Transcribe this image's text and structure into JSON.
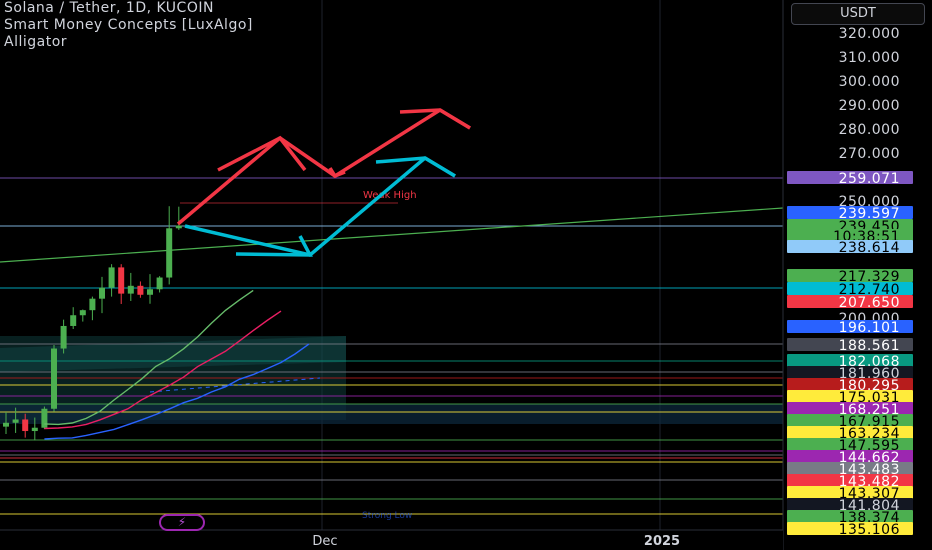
{
  "legend": {
    "title": "Solana / Tether, 1D, KUCOIN",
    "indicator1": "Smart Money Concepts [LuxAlgo]",
    "indicator2": "Alligator"
  },
  "currency": "USDT",
  "colors": {
    "bull": "#26a69a",
    "bear": "#ef5350",
    "candle_bull": "#4caf50",
    "candle_bear": "#f23645",
    "red_arrow": "#f23645",
    "cyan_arrow": "#00bcd4",
    "trend_line": "#4caf50",
    "alligator_lips": "#66bb6a",
    "alligator_teeth": "#e91e63",
    "alligator_jaw": "#2962ff",
    "weak_high_line": "#7e57c2"
  },
  "chart_data": {
    "type": "candlestick",
    "y_axis": {
      "ticks": [
        "320.000",
        "310.000",
        "300.000",
        "290.000",
        "280.000",
        "270.000",
        "250.000",
        "200.000"
      ],
      "range": [
        134,
        325
      ]
    },
    "x_axis": {
      "ticks": [
        "Dec",
        "2025"
      ]
    },
    "candles": [
      {
        "o": 160.5,
        "h": 165.8,
        "l": 157.8,
        "c": 161.9
      },
      {
        "o": 161.9,
        "h": 167.4,
        "l": 158.2,
        "c": 163.1
      },
      {
        "o": 163.1,
        "h": 165.2,
        "l": 156.5,
        "c": 158.9
      },
      {
        "o": 158.9,
        "h": 163.8,
        "l": 155.5,
        "c": 160.1
      },
      {
        "o": 160.1,
        "h": 167.8,
        "l": 159.6,
        "c": 167.0
      },
      {
        "o": 167.0,
        "h": 190.2,
        "l": 165.9,
        "c": 188.9
      },
      {
        "o": 188.9,
        "h": 199.4,
        "l": 187.1,
        "c": 197.1
      },
      {
        "o": 197.1,
        "h": 204.7,
        "l": 196.0,
        "c": 201.2
      },
      {
        "o": 201.2,
        "h": 203.7,
        "l": 198.7,
        "c": 203.4
      },
      {
        "o": 203.4,
        "h": 209.3,
        "l": 199.2,
        "c": 208.4
      },
      {
        "o": 208.4,
        "h": 217.9,
        "l": 202.1,
        "c": 213.2
      },
      {
        "o": 213.2,
        "h": 223.4,
        "l": 209.3,
        "c": 222.0
      },
      {
        "o": 222.0,
        "h": 223.4,
        "l": 206.1,
        "c": 210.6
      },
      {
        "o": 210.6,
        "h": 219.6,
        "l": 207.4,
        "c": 214.0
      },
      {
        "o": 214.0,
        "h": 215.9,
        "l": 208.8,
        "c": 210.1
      },
      {
        "o": 210.1,
        "h": 219.1,
        "l": 206.2,
        "c": 212.5
      },
      {
        "o": 212.5,
        "h": 218.2,
        "l": 211.1,
        "c": 217.6
      },
      {
        "o": 217.6,
        "h": 248.6,
        "l": 214.6,
        "c": 239.0
      },
      {
        "o": 239.0,
        "h": 248.4,
        "l": 238.3,
        "c": 240.2
      }
    ],
    "alligator": {
      "lips": [
        161.5,
        161.3,
        161.8,
        163.5,
        166.1,
        170.2,
        174.0,
        177.9,
        182.4,
        185.2,
        188.8,
        193.1,
        198.1,
        203.3,
        207.8,
        212.0
      ],
      "teeth": [
        159.8,
        160.0,
        160.4,
        161.3,
        163.0,
        165.0,
        167.0,
        170.3,
        172.9,
        175.6,
        178.5,
        182.3,
        185.1,
        187.9,
        191.6,
        195.4,
        199.1,
        203.0
      ],
      "jaw": [
        156.0,
        156.3,
        156.4,
        157.3,
        158.4,
        159.5,
        161.2,
        163.0,
        164.9,
        167.0,
        169.2,
        170.8,
        173.1,
        175.0,
        177.7,
        179.4,
        181.6,
        183.8,
        186.9,
        190.5
      ]
    },
    "horizontal_levels": [
      259.071,
      239.597,
      212.74,
      188.561,
      182.068,
      181.96,
      180.295,
      175.031,
      168.251,
      167.915,
      163.234,
      147.595,
      144.662,
      143.483,
      143.482,
      143.307,
      141.804,
      138.374,
      135.106
    ],
    "price_labels": [
      {
        "value": "259.071",
        "y": 259.071,
        "color": "#7e57c2",
        "text_color": "#ffffff"
      },
      {
        "value": "239.597",
        "y": 244.9,
        "color": "#2962ff",
        "text_color": "#ffffff"
      },
      {
        "value": "239.450",
        "y": 239.8,
        "color": "#4caf50",
        "text_color": "#000000"
      },
      {
        "value": "10:38:51",
        "y": 235.4,
        "color": "#4caf50",
        "text_color": "#000000"
      },
      {
        "value": "238.614",
        "y": 230.6,
        "color": "#90caf9",
        "text_color": "#000000"
      },
      {
        "value": "217.329",
        "y": 217.2,
        "color": "#4caf50",
        "text_color": "#000000"
      },
      {
        "value": "212.740",
        "y": 212.4,
        "color": "#00bcd4",
        "text_color": "#000000"
      },
      {
        "value": "207.650",
        "y": 207.6,
        "color": "#f23645",
        "text_color": "#ffffff"
      },
      {
        "value": "196.101",
        "y": 196.1,
        "color": "#2962ff",
        "text_color": "#ffffff"
      },
      {
        "value": "188.561",
        "y": 188.9,
        "color": "#434651",
        "text_color": "#ffffff"
      },
      {
        "value": "182.068",
        "y": 183.7,
        "color": "#089981",
        "text_color": "#ffffff"
      },
      {
        "value": "181.960",
        "y": 178.8,
        "color": "#131722",
        "text_color": "#d1d4dc"
      },
      {
        "value": "180.295",
        "y": 173.7,
        "color": "#b71c1c",
        "text_color": "#ffffff"
      },
      {
        "value": "175.031",
        "y": 168.6,
        "color": "#ffeb3b",
        "text_color": "#000000"
      },
      {
        "value": "168.251",
        "y": 163.6,
        "color": "#9c27b0",
        "text_color": "#ffffff"
      },
      {
        "value": "167.915",
        "y": 158.7,
        "color": "#4caf50",
        "text_color": "#000000"
      },
      {
        "value": "163.234",
        "y": 153.9,
        "color": "#ffeb3b",
        "text_color": "#000000"
      },
      {
        "value": "147.595",
        "y": 148.8,
        "color": "#4caf50",
        "text_color": "#000000"
      },
      {
        "value": "144.662",
        "y": 143.7,
        "color": "#9c27b0",
        "text_color": "#ffffff"
      },
      {
        "value": "143.483",
        "y": 138.5,
        "color": "#787b86",
        "text_color": "#ffffff"
      },
      {
        "value": "143.482",
        "y": 133.6,
        "color": "#f23645",
        "text_color": "#ffffff"
      },
      {
        "value": "143.307",
        "y": 128.6,
        "color": "#ffeb3b",
        "text_color": "#000000"
      },
      {
        "value": "141.804",
        "y": 123.6,
        "color": "#131722",
        "text_color": "#d1d4dc"
      },
      {
        "value": "138.374",
        "y": 118.6,
        "color": "#4caf50",
        "text_color": "#000000"
      },
      {
        "value": "135.106",
        "y": 113.6,
        "color": "#ffeb3b",
        "text_color": "#000000"
      }
    ],
    "annotations": [
      "Weak High",
      "Strong Low"
    ],
    "grid": true
  }
}
